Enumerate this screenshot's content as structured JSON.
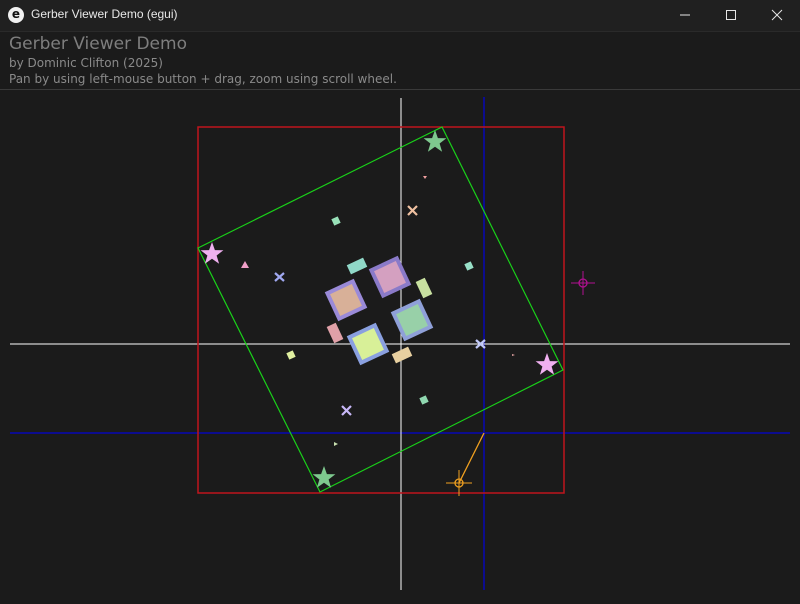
{
  "window": {
    "title": "Gerber Viewer Demo (egui)",
    "app_icon": "e",
    "controls": [
      "minimize-icon",
      "maximize-icon",
      "close-icon"
    ]
  },
  "header": {
    "title": "Gerber Viewer Demo",
    "author": "by Dominic Clifton (2025)",
    "instructions": "Pan by using left-mouse button + drag, zoom using scroll wheel."
  },
  "colors": {
    "background": "#1b1b1b",
    "bounding_box": "#c0141c",
    "rotated_outline": "#19d119",
    "crosshair": "#ffffff",
    "origin_axes": "#0c0c8f",
    "marker_orange": "#f0a020",
    "marker_magenta": "#b01090"
  }
}
